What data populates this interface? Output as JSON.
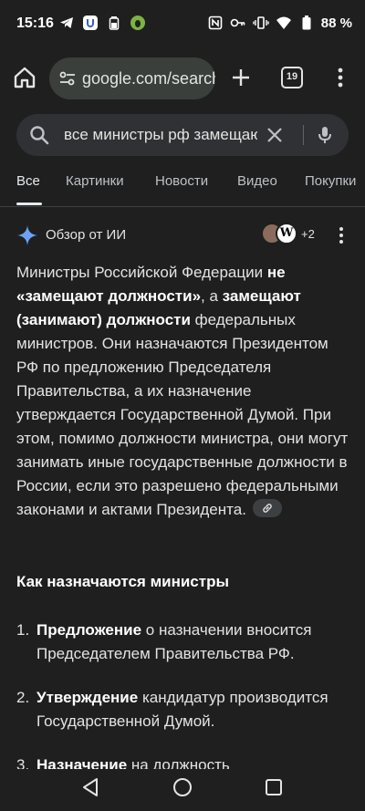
{
  "status_bar": {
    "time": "15:16",
    "battery": "88 %"
  },
  "browser": {
    "url": "google.com/search",
    "tab_count": "19"
  },
  "search": {
    "query": "все министры рф замещают должности"
  },
  "tabs": [
    {
      "label": "Все"
    },
    {
      "label": "Картинки"
    },
    {
      "label": "Новости"
    },
    {
      "label": "Видео"
    },
    {
      "label": "Покупки"
    }
  ],
  "ai_overview": {
    "title": "Обзор от ИИ",
    "source_count": "+2",
    "source_avatar_letter": "W",
    "paragraph": {
      "t1": "Министры Российской Федерации ",
      "b1": "не «замещают должности»",
      "t2": ", а ",
      "b2": "замещают (занимают) должности",
      "t3": " федеральных министров. Они назначаются Президентом РФ по предложению Председателя Правительства, а их назначение утверждается Государственной Думой. При этом, помимо должности министра, они могут занимать иные государственные должности в России, если это разрешено федеральными законами и актами Президента."
    },
    "section_heading": "Как назначаются министры",
    "steps": [
      {
        "num": "1.",
        "bold": "Предложение",
        "text": " о назначении вносится Председателем Правительства РФ."
      },
      {
        "num": "2.",
        "bold": "Утверждение",
        "text": " кандидатур производится Государственной Думой."
      },
      {
        "num": "3.",
        "bold": "Назначение",
        "text": " на должность"
      }
    ]
  },
  "colors": {
    "background": "#1f1f1f",
    "search_box": "#303134",
    "url_bar": "#3a3f3b",
    "text": "#e3e3e3"
  }
}
